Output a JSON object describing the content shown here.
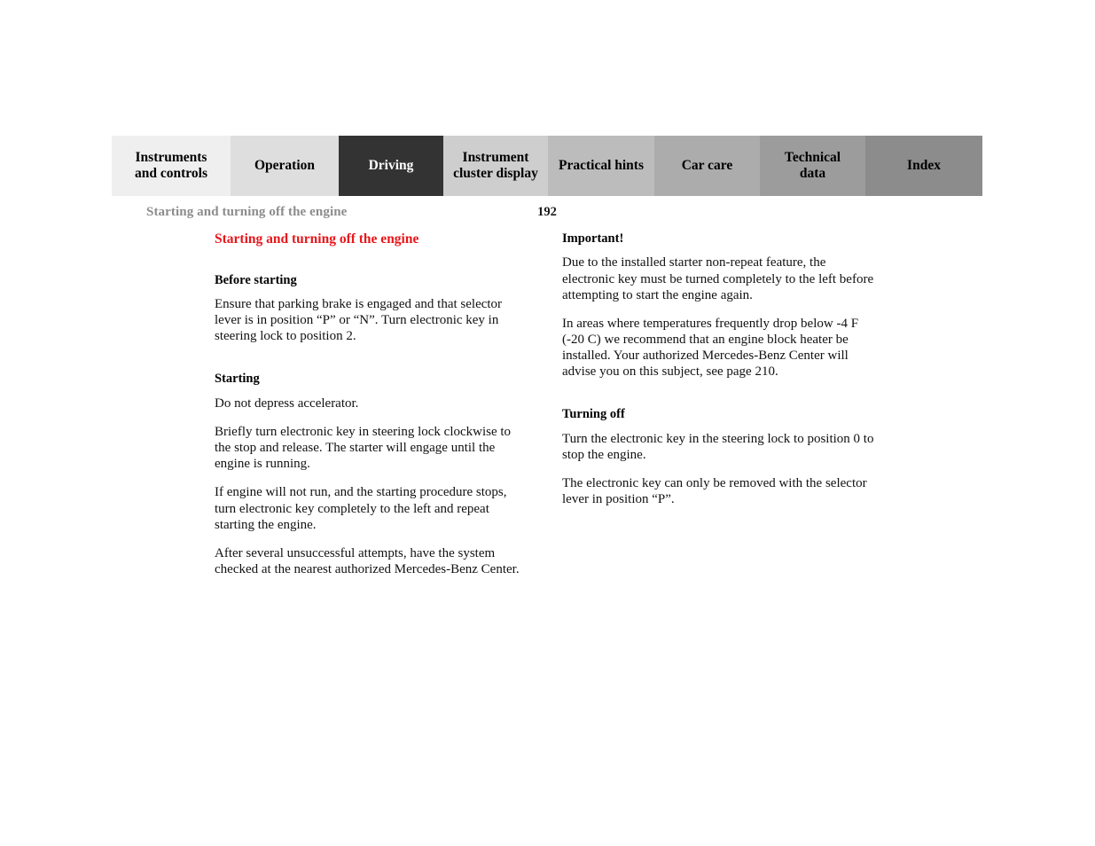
{
  "tabs": [
    {
      "label": "Instruments\nand controls",
      "name": "tab-instruments-and-controls",
      "bg": "#efefef",
      "active": false
    },
    {
      "label": "Operation",
      "name": "tab-operation",
      "bg": "#dedede",
      "active": false
    },
    {
      "label": "Driving",
      "name": "tab-driving",
      "bg": "#333333",
      "active": true
    },
    {
      "label": "Instrument\ncluster display",
      "name": "tab-instrument-cluster-display",
      "bg": "#cecece",
      "active": false
    },
    {
      "label": "Practical hints",
      "name": "tab-practical-hints",
      "bg": "#bcbcbc",
      "active": false
    },
    {
      "label": "Car care",
      "name": "tab-car-care",
      "bg": "#acacac",
      "active": false
    },
    {
      "label": "Technical\ndata",
      "name": "tab-technical-data",
      "bg": "#9c9c9c",
      "active": false
    },
    {
      "label": "Index",
      "name": "tab-index",
      "bg": "#8c8c8c",
      "active": false
    }
  ],
  "tab_widths": [
    134,
    122,
    118,
    118,
    120,
    119,
    119,
    132
  ],
  "header": {
    "running_head": "Starting and turning off the engine",
    "page_number": "192"
  },
  "colors": {
    "title_red": "#e8161b",
    "running_head_gray": "#8c8c8c",
    "active_tab_bg": "#333333",
    "body_text": "#111111"
  },
  "left_column": {
    "title": "Starting and turning off the engine",
    "sections": [
      {
        "heading": "Before starting",
        "paragraphs": [
          "Ensure that parking brake is engaged and that selector lever is in position “P” or “N”. Turn electronic key in steering lock to position 2."
        ]
      },
      {
        "heading": "Starting",
        "paragraphs": [
          "Do not depress accelerator.",
          "Briefly turn electronic key in steering lock clockwise to the stop and release. The starter will engage until the engine is running.",
          "If engine will not run, and the starting procedure stops, turn electronic key completely to the left and repeat starting the engine.",
          "After several unsuccessful attempts, have the system checked at the nearest authorized Mercedes-Benz Center."
        ]
      }
    ]
  },
  "right_column": {
    "sections": [
      {
        "heading": "Important!",
        "paragraphs": [
          "Due to the installed starter non-repeat feature, the electronic key must be turned completely to the left before attempting to start the engine again.",
          "In areas where temperatures frequently drop below -4  F (-20  C) we recommend that an engine block heater be installed. Your authorized Mercedes-Benz Center will advise you on this subject, see page 210."
        ]
      },
      {
        "heading": "Turning off",
        "paragraphs": [
          "Turn the electronic key in the steering lock to position 0 to stop the engine.",
          "The electronic key can only be removed with the selector lever in position “P”."
        ]
      }
    ]
  }
}
